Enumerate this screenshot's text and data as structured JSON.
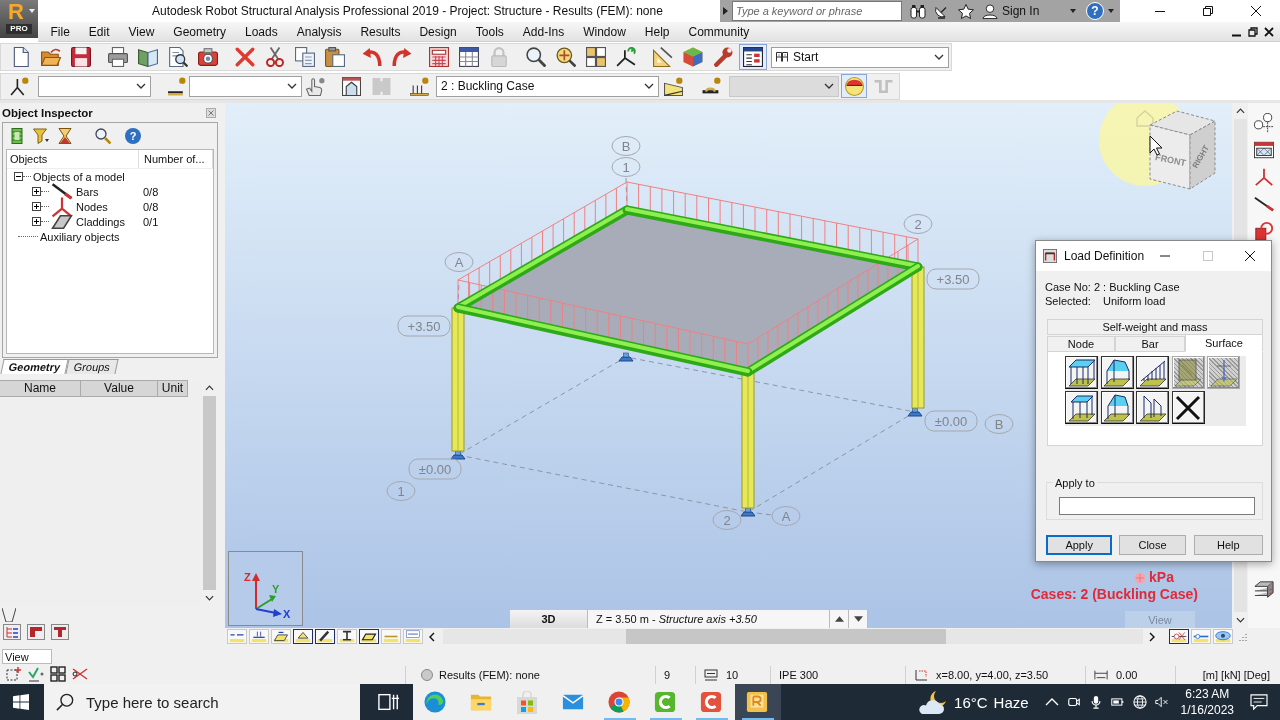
{
  "app_button": {
    "label": "R",
    "edition": "PRO"
  },
  "window": {
    "title": "Autodesk Robot Structural Analysis Professional 2019 - Project: Structure - Results (FEM): none"
  },
  "infocenter": {
    "placeholder": "Type a keyword or phrase",
    "sign_in": "Sign In",
    "help": "?"
  },
  "menu": [
    "File",
    "Edit",
    "View",
    "Geometry",
    "Loads",
    "Analysis",
    "Results",
    "Design",
    "Tools",
    "Add-Ins",
    "Window",
    "Help",
    "Community"
  ],
  "toolbar_1": {
    "buttons": [
      {
        "kind": "new",
        "disabled": false,
        "pressed": false
      },
      {
        "kind": "open",
        "disabled": false,
        "pressed": false
      },
      {
        "kind": "save",
        "disabled": false,
        "pressed": false
      },
      {
        "kind": "print",
        "disabled": false,
        "pressed": false
      },
      {
        "kind": "book",
        "disabled": false,
        "pressed": false
      },
      {
        "kind": "preview",
        "disabled": false,
        "pressed": false
      },
      {
        "kind": "camera",
        "disabled": false,
        "pressed": false
      },
      {
        "kind": "delete",
        "disabled": false,
        "pressed": false
      },
      {
        "kind": "cut",
        "disabled": false,
        "pressed": false
      },
      {
        "kind": "copy",
        "disabled": false,
        "pressed": false
      },
      {
        "kind": "paste",
        "disabled": false,
        "pressed": false
      },
      {
        "kind": "undo",
        "disabled": false,
        "pressed": false
      },
      {
        "kind": "redo",
        "disabled": false,
        "pressed": false
      },
      {
        "kind": "calculator",
        "disabled": false,
        "pressed": false
      },
      {
        "kind": "table",
        "disabled": false,
        "pressed": false
      },
      {
        "kind": "lock",
        "disabled": true,
        "pressed": false
      },
      {
        "kind": "zoom",
        "disabled": false,
        "pressed": false
      },
      {
        "kind": "zoom-pan",
        "disabled": false,
        "pressed": false
      },
      {
        "kind": "grid-view",
        "disabled": false,
        "pressed": false
      },
      {
        "kind": "axes",
        "disabled": false,
        "pressed": false
      },
      {
        "kind": "drafting",
        "disabled": false,
        "pressed": false
      },
      {
        "kind": "cube",
        "disabled": false,
        "pressed": false
      },
      {
        "kind": "wrench",
        "disabled": false,
        "pressed": false
      },
      {
        "kind": "layout",
        "disabled": false,
        "pressed": true
      }
    ],
    "layout_dropdown": {
      "value": "Start"
    }
  },
  "toolbar_2": {
    "items": [
      {
        "kind": "node-query",
        "disabled": false,
        "pressed": false
      },
      {
        "kind": "dropdown",
        "disabled": false,
        "pressed": false
      },
      {
        "kind": "bar-query",
        "disabled": false,
        "pressed": false
      },
      {
        "kind": "dropdown",
        "disabled": false,
        "pressed": false
      },
      {
        "kind": "hand-query",
        "disabled": false,
        "pressed": false
      },
      {
        "kind": "frame",
        "disabled": false,
        "pressed": false
      },
      {
        "kind": "panel",
        "disabled": true,
        "pressed": false
      },
      {
        "kind": "load-query",
        "disabled": false,
        "pressed": false
      },
      {
        "kind": "dropdown",
        "disabled": false,
        "pressed": false,
        "value": "2 : Buckling Case"
      },
      {
        "kind": "load-display",
        "disabled": false,
        "pressed": false
      },
      {
        "kind": "member-query",
        "disabled": false,
        "pressed": false
      },
      {
        "kind": "dropdown",
        "disabled": true,
        "pressed": false
      },
      {
        "kind": "load-symbol",
        "disabled": false,
        "pressed": true
      },
      {
        "kind": "wave",
        "disabled": true,
        "pressed": false
      }
    ]
  },
  "object_inspector": {
    "title": "Object Inspector",
    "help": "?",
    "columns": [
      "Objects",
      "Number of..."
    ],
    "tree": [
      {
        "label": "Objects of a model",
        "expanded": true,
        "children": [
          {
            "label": "Bars",
            "kind": "bar",
            "count": "0/8",
            "expanded": false
          },
          {
            "label": "Nodes",
            "kind": "node",
            "count": "0/8",
            "expanded": false
          },
          {
            "label": "Claddings",
            "kind": "cladding",
            "count": "0/1",
            "expanded": false
          }
        ]
      },
      {
        "label": "Auxiliary objects"
      }
    ],
    "tabs": [
      {
        "label": "Geometry",
        "selected": true
      },
      {
        "label": "Groups",
        "selected": false
      }
    ],
    "properties": {
      "columns": [
        "Name",
        "Value",
        "Unit"
      ]
    }
  },
  "view_field": {
    "value": "View"
  },
  "viewport": {
    "grid_axes": [
      "B",
      "1",
      "2",
      "A",
      "B",
      "1",
      "2",
      "A"
    ],
    "levels": [
      "+3.50",
      "+3.50",
      "±0.00",
      "±0.00"
    ],
    "view_cube": [
      "FRONT",
      "RIGHT"
    ],
    "triad": [
      "Z",
      "Y",
      "X"
    ],
    "load_unit": "kPa",
    "cases": "Cases: 2 (Buckling Case)",
    "view_mode": "3D",
    "plane": "Z = 3.50 m - *Structure axis +3.50*",
    "view_tab": "View"
  },
  "viewport_toolbar": {
    "left": [
      {
        "kind": "node-numbers",
        "pressed": false
      },
      {
        "kind": "bar-numbers",
        "pressed": false
      },
      {
        "kind": "panel-numbers",
        "pressed": false
      },
      {
        "kind": "supports",
        "pressed": true
      },
      {
        "kind": "bar-symbols",
        "pressed": true
      },
      {
        "kind": "sections",
        "pressed": false
      },
      {
        "kind": "panels",
        "pressed": true
      },
      {
        "kind": "bars",
        "pressed": false
      },
      {
        "kind": "values",
        "pressed": false
      }
    ],
    "right": [
      {
        "kind": "releases",
        "pressed": true
      },
      {
        "kind": "offsets",
        "pressed": false
      },
      {
        "kind": "eye",
        "pressed": false
      }
    ]
  },
  "load_definition": {
    "title": "Load Definition",
    "case": "Case No: 2 : Buckling Case",
    "selected_label": "Selected:",
    "selected_value": "Uniform load",
    "tabs": [
      {
        "label": "Self-weight and mass",
        "selected": false
      },
      {
        "label": "Node",
        "selected": false
      },
      {
        "label": "Bar",
        "selected": false
      },
      {
        "label": "Surface",
        "selected": true
      }
    ],
    "load_types": [
      {
        "kind": "uniform",
        "disabled": false
      },
      {
        "kind": "tent",
        "disabled": false
      },
      {
        "kind": "ramp",
        "disabled": false
      },
      {
        "kind": "box",
        "disabled": true
      },
      {
        "kind": "arrow",
        "disabled": true
      },
      {
        "kind": "uniform-contour",
        "disabled": false
      },
      {
        "kind": "tent-contour",
        "disabled": false
      },
      {
        "kind": "ramp-contour",
        "disabled": false
      },
      {
        "kind": "delete",
        "disabled": false
      }
    ],
    "apply_to": {
      "label": "Apply to"
    },
    "buttons": [
      {
        "label": "Apply",
        "default": true
      },
      {
        "label": "Close",
        "default": false
      },
      {
        "label": "Help",
        "default": false
      }
    ]
  },
  "status_bar": {
    "results": "Results (FEM): none",
    "cell_2": "9",
    "cell_3": "10",
    "section": "IPE 300",
    "coordinates": "x=8.00, y=4.00, z=3.50",
    "cell_6": "0.00",
    "units": "[m] [kN] [Deg]"
  },
  "taskbar": {
    "search": {
      "placeholder": "Type here to search"
    },
    "apps": [
      {
        "kind": "edge",
        "running": false,
        "selected": false
      },
      {
        "kind": "folder",
        "running": false,
        "selected": false
      },
      {
        "kind": "store",
        "running": false,
        "selected": false
      },
      {
        "kind": "mail",
        "running": false,
        "selected": false
      },
      {
        "kind": "browser",
        "running": true,
        "selected": false
      },
      {
        "kind": "recorder",
        "running": true,
        "selected": false
      },
      {
        "kind": "editor",
        "running": true,
        "selected": false
      },
      {
        "kind": "robot",
        "running": true,
        "selected": true
      }
    ],
    "weather": {
      "temperature": "16°C",
      "condition": "Haze"
    },
    "clock": {
      "time": "6:23 AM",
      "date": "1/16/2023"
    }
  }
}
